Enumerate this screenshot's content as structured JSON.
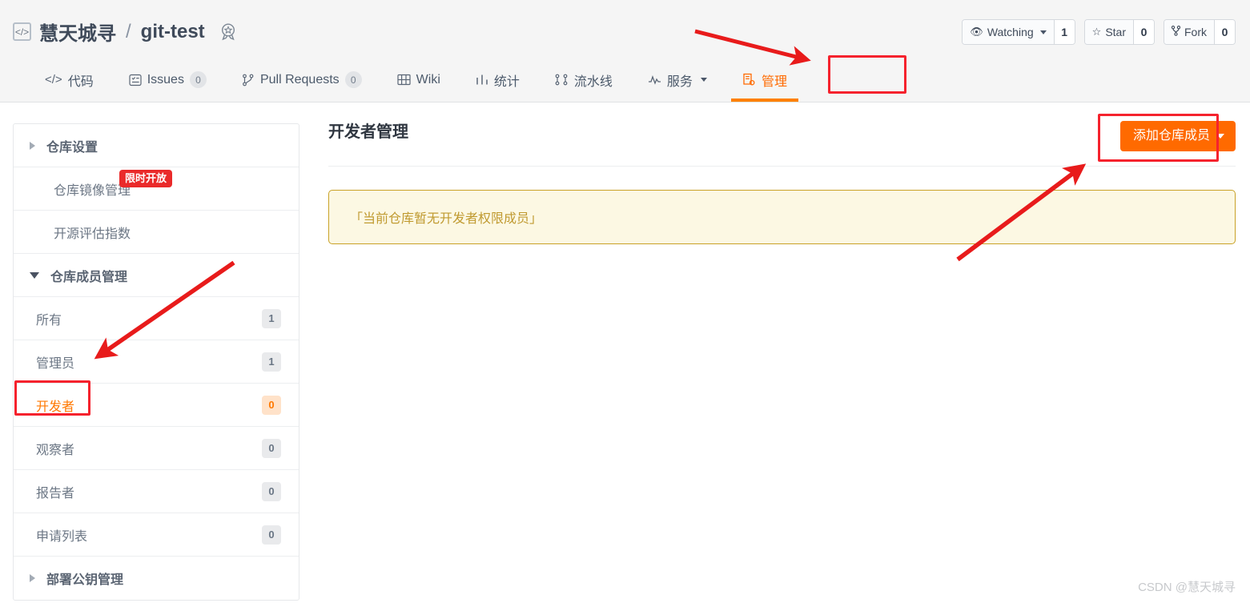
{
  "header": {
    "code_icon": "code-icon",
    "owner": "慧天城寻",
    "separator": "/",
    "repo": "git-test",
    "medal_icon": "medal-badge-icon",
    "watching_label": "Watching",
    "watching_count": "1",
    "star_label": "Star",
    "star_count": "0",
    "fork_label": "Fork",
    "fork_count": "0"
  },
  "nav": {
    "items": [
      {
        "label": "代码",
        "icon": "code-angle-icon",
        "count": null,
        "active": false
      },
      {
        "label": "Issues",
        "icon": "issues-icon",
        "count": "0",
        "active": false
      },
      {
        "label": "Pull Requests",
        "icon": "pull-request-icon",
        "count": "0",
        "active": false
      },
      {
        "label": "Wiki",
        "icon": "wiki-book-icon",
        "count": null,
        "active": false
      },
      {
        "label": "统计",
        "icon": "chart-bars-icon",
        "count": null,
        "active": false
      },
      {
        "label": "流水线",
        "icon": "pipeline-icon",
        "count": null,
        "active": false
      },
      {
        "label": "服务",
        "icon": "activity-line-icon",
        "count": null,
        "active": false,
        "caret": true
      },
      {
        "label": "管理",
        "icon": "manage-doc-icon",
        "count": null,
        "active": true
      }
    ]
  },
  "sidebar": {
    "repo_settings": {
      "label": "仓库设置",
      "expanded": false
    },
    "mirror": {
      "label": "仓库镜像管理",
      "tag": "限时开放"
    },
    "oss_index": {
      "label": "开源评估指数"
    },
    "members_group": {
      "label": "仓库成员管理",
      "expanded": true
    },
    "members": [
      {
        "label": "所有",
        "count": "1",
        "active": false
      },
      {
        "label": "管理员",
        "count": "1",
        "active": false
      },
      {
        "label": "开发者",
        "count": "0",
        "active": true
      },
      {
        "label": "观察者",
        "count": "0",
        "active": false
      },
      {
        "label": "报告者",
        "count": "0",
        "active": false
      },
      {
        "label": "申请列表",
        "count": "0",
        "active": false
      }
    ],
    "deploy_keys": {
      "label": "部署公钥管理",
      "expanded": false
    }
  },
  "main": {
    "page_title": "开发者管理",
    "add_member_button": "添加仓库成员",
    "empty_notice": "「当前仓库暂无开发者权限成员」"
  },
  "watermark": "CSDN @慧天城寻",
  "colors": {
    "accent_orange": "#ff6a00",
    "highlight_red": "#f5222d",
    "alert_bg": "#fcf8e3",
    "alert_border": "#c9a227",
    "alert_text": "#c09a30",
    "header_bg": "#f5f5f5"
  }
}
